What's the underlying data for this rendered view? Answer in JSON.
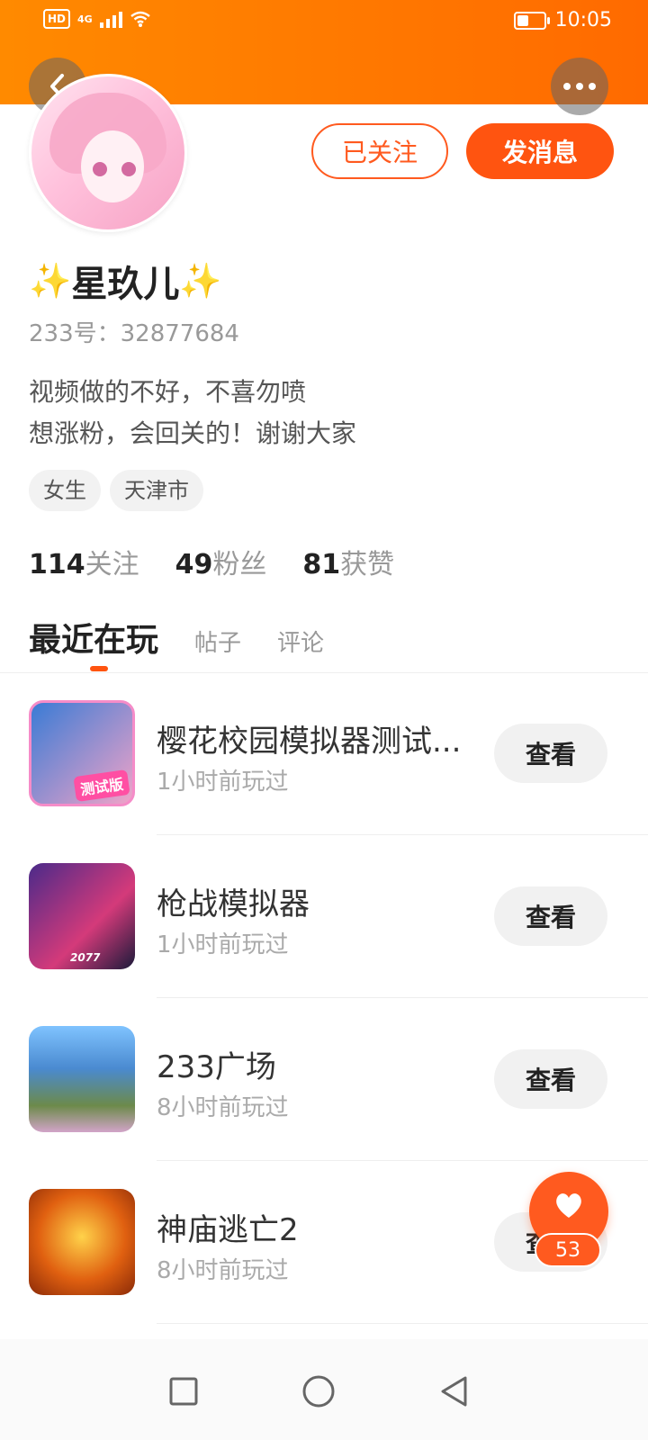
{
  "status_bar": {
    "hd_label": "HD",
    "network_label": "4G",
    "time": "10:05"
  },
  "profile": {
    "name": "星玖儿",
    "name_decoration_left": "✨",
    "name_decoration_right": "✨",
    "uid": "233号：32877684",
    "bio_line1": "视频做的不好，不喜勿喷",
    "bio_line2": "想涨粉，会回关的！谢谢大家",
    "tags": [
      "女生",
      "天津市"
    ],
    "follow_button": "已关注",
    "message_button": "发消息",
    "stats": {
      "following_count": "114",
      "following_label": "关注",
      "fans_count": "49",
      "fans_label": "粉丝",
      "likes_count": "81",
      "likes_label": "获赞"
    }
  },
  "tabs": [
    {
      "label": "最近在玩",
      "active": true
    },
    {
      "label": "帖子",
      "active": false
    },
    {
      "label": "评论",
      "active": false
    }
  ],
  "games": [
    {
      "title": "樱花校园模拟器测试...",
      "played": "1小时前玩过",
      "action": "查看",
      "icon_badge": "测试版"
    },
    {
      "title": "枪战模拟器",
      "played": "1小时前玩过",
      "action": "查看",
      "icon_badge": "2077"
    },
    {
      "title": "233广场",
      "played": "8小时前玩过",
      "action": "查看"
    },
    {
      "title": "神庙逃亡2",
      "played": "8小时前玩过",
      "action": "查看"
    }
  ],
  "fab": {
    "icon": "heart-icon",
    "count": "53"
  },
  "colors": {
    "accent": "#ff5410",
    "header_gradient_start": "#ff8a00",
    "header_gradient_end": "#ff6a00"
  }
}
